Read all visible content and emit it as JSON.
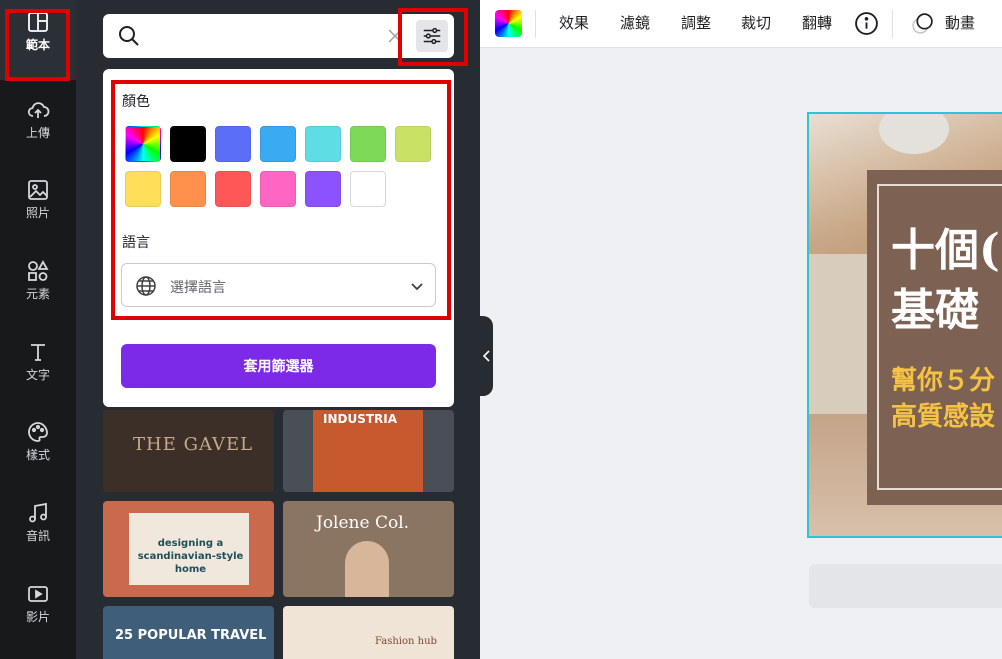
{
  "rail": {
    "items": [
      {
        "label": "範本",
        "icon": "template-icon"
      },
      {
        "label": "上傳",
        "icon": "upload-icon"
      },
      {
        "label": "照片",
        "icon": "photo-icon"
      },
      {
        "label": "元素",
        "icon": "elements-icon"
      },
      {
        "label": "文字",
        "icon": "text-icon"
      },
      {
        "label": "樣式",
        "icon": "palette-icon"
      },
      {
        "label": "音訊",
        "icon": "music-icon"
      },
      {
        "label": "影片",
        "icon": "video-icon"
      }
    ]
  },
  "search": {
    "value": "",
    "placeholder": ""
  },
  "filter": {
    "color_title": "顏色",
    "colors": [
      "rainbow",
      "#000000",
      "#5b6ef7",
      "#3aaaf3",
      "#5fdde5",
      "#7ed957",
      "#c9e265",
      "#ffde59",
      "#ff914d",
      "#ff5757",
      "#ff66c4",
      "#8c52ff",
      "#ffffff"
    ],
    "language_title": "語言",
    "language_placeholder": "選擇語言",
    "apply_label": "套用篩選器"
  },
  "thumbnails": [
    {
      "title": "THE GAVEL"
    },
    {
      "title": "INDUSTRIA"
    },
    {
      "title": "designing a scandinavian-style home"
    },
    {
      "title": "Jolene Col."
    },
    {
      "title": "25 POPULAR TRAVEL"
    },
    {
      "title": "Fashion hub"
    }
  ],
  "toolbar": {
    "effects": "效果",
    "filters": "濾鏡",
    "adjust": "調整",
    "crop": "裁切",
    "flip": "翻轉",
    "animate": "動畫"
  },
  "design": {
    "headline_line1": "十個(",
    "headline_line2": "基礎",
    "sub_line1": "幫你５分",
    "sub_line2": "高質感設"
  }
}
